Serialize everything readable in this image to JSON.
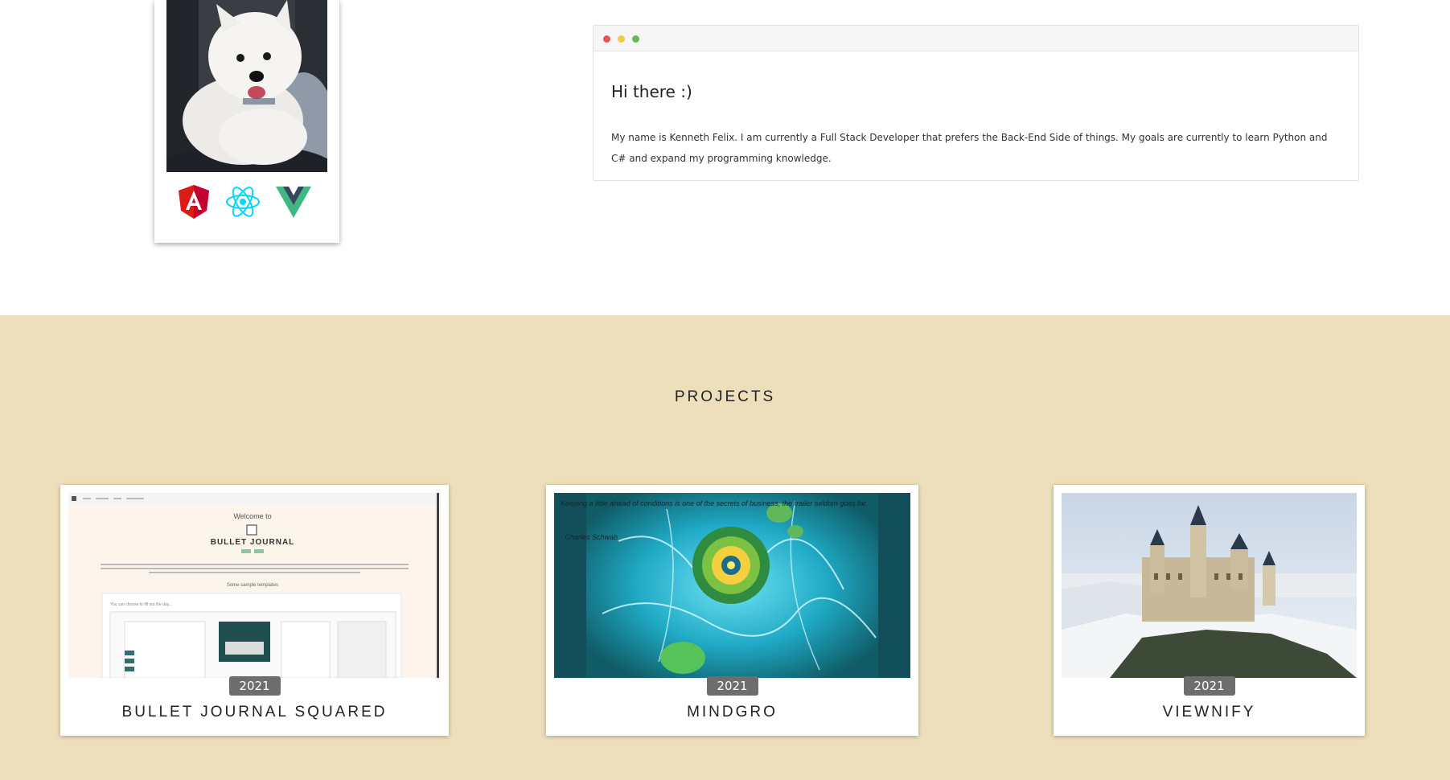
{
  "profile": {
    "photo_icon": "dog-photo",
    "tech_icons": [
      "angular-icon",
      "react-icon",
      "vue-icon"
    ]
  },
  "terminal": {
    "greeting": "Hi there :)",
    "bio": "My name is Kenneth Felix. I am currently a Full Stack Developer that prefers the Back-End Side of things. My goals are currently to learn Python and C# and expand my programming knowledge."
  },
  "projects": {
    "title": "PROJECTS",
    "items": [
      {
        "name": "BULLET JOURNAL SQUARED",
        "year": "2021",
        "thumb_text": {
          "welcome": "Welcome to",
          "brand": "BULLET JOURNAL",
          "templates": "Some sample templates",
          "fill": "You can choose to fill out the day..."
        }
      },
      {
        "name": "MINDGRO",
        "year": "2021",
        "thumb_text": {
          "quote": "Keeping a little ahead of conditions is one of the secrets of business, the trailer seldom goes far.",
          "author": "- Charles Schwab"
        }
      },
      {
        "name": "VIEWNIFY",
        "year": "2021"
      }
    ]
  },
  "colors": {
    "projects_bg": "#eddfbb",
    "badge_bg": "#6d6d6d",
    "angular": "#dd1b16",
    "react": "#00d8ff",
    "vue": "#41b883"
  }
}
